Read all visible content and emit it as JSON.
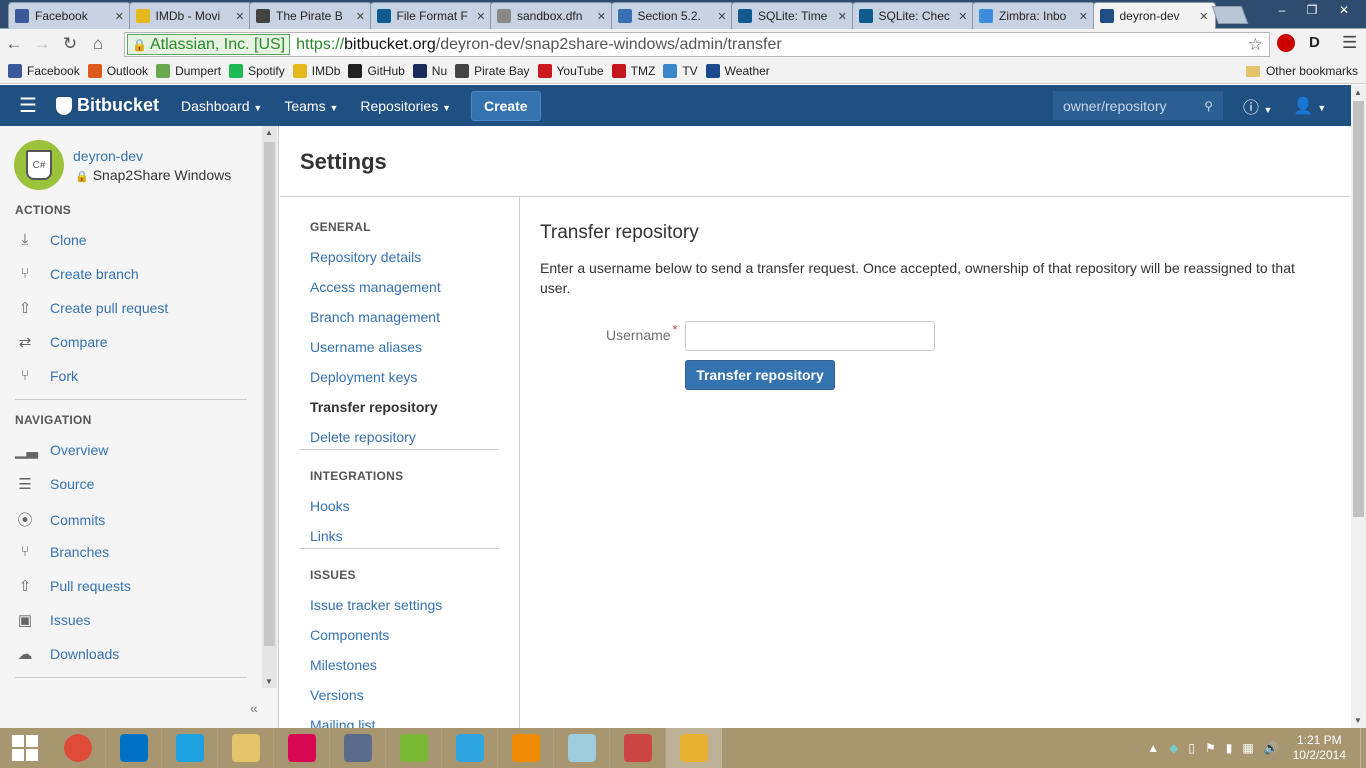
{
  "browser": {
    "tabs": [
      {
        "label": "Facebook",
        "icon": "facebook-icon",
        "color": "#3b5998"
      },
      {
        "label": "IMDb - Movi",
        "icon": "imdb-icon",
        "color": "#e5b91d"
      },
      {
        "label": "The Pirate B",
        "icon": "pirate-ship-icon",
        "color": "#444444"
      },
      {
        "label": "File Format F",
        "icon": "sqlite-icon",
        "color": "#0f5a8e"
      },
      {
        "label": "sandbox.dfn",
        "icon": "document-icon",
        "color": "#888888"
      },
      {
        "label": "Section 5.2.",
        "icon": "curve-icon",
        "color": "#3a6fb3"
      },
      {
        "label": "SQLite: Time",
        "icon": "sqlite-icon",
        "color": "#0f5a8e"
      },
      {
        "label": "SQLite: Chec",
        "icon": "sqlite-icon",
        "color": "#0f5a8e"
      },
      {
        "label": "Zimbra: Inbo",
        "icon": "zimbra-icon",
        "color": "#3b8ede"
      },
      {
        "label": "deyron-dev",
        "icon": "bitbucket-icon",
        "color": "#205081"
      }
    ],
    "ev_cert": "Atlassian, Inc. [US]",
    "url_scheme": "https://",
    "url_host": "bitbucket.org",
    "url_path": "/deyron-dev/snap2share-windows/admin/transfer",
    "bookmarks": [
      {
        "label": "Facebook",
        "icon": "facebook-icon",
        "color": "#3b5998"
      },
      {
        "label": "Outlook",
        "icon": "outlook-icon",
        "color": "#e05a1c"
      },
      {
        "label": "Dumpert",
        "icon": "dumpert-icon",
        "color": "#6aa84f"
      },
      {
        "label": "Spotify",
        "icon": "spotify-icon",
        "color": "#1db954"
      },
      {
        "label": "IMDb",
        "icon": "imdb-icon",
        "color": "#e5b91d"
      },
      {
        "label": "GitHub",
        "icon": "github-icon",
        "color": "#222222"
      },
      {
        "label": "Nu",
        "icon": "nu-icon",
        "color": "#1a2b5c"
      },
      {
        "label": "Pirate Bay",
        "icon": "pirate-ship-icon",
        "color": "#444444"
      },
      {
        "label": "YouTube",
        "icon": "youtube-icon",
        "color": "#cc181e"
      },
      {
        "label": "TMZ",
        "icon": "tmz-icon",
        "color": "#c4161c"
      },
      {
        "label": "TV",
        "icon": "tv-icon",
        "color": "#3a86c8"
      },
      {
        "label": "Weather",
        "icon": "twc-icon",
        "color": "#1b4a8c"
      }
    ],
    "other_bookmarks": "Other bookmarks"
  },
  "header": {
    "logo": "Bitbucket",
    "nav": [
      "Dashboard",
      "Teams",
      "Repositories"
    ],
    "create": "Create",
    "search_placeholder": "owner/repository"
  },
  "sidebar": {
    "owner": "deyron-dev",
    "repo": "Snap2Share Windows",
    "avatar_text": "C#",
    "actions_heading": "ACTIONS",
    "actions": [
      {
        "label": "Clone",
        "icon": "download-icon"
      },
      {
        "label": "Create branch",
        "icon": "branch-plus-icon"
      },
      {
        "label": "Create pull request",
        "icon": "pull-request-plus-icon"
      },
      {
        "label": "Compare",
        "icon": "shuffle-icon"
      },
      {
        "label": "Fork",
        "icon": "fork-icon"
      }
    ],
    "navigation_heading": "NAVIGATION",
    "navigation": [
      {
        "label": "Overview",
        "icon": "bar-chart-icon"
      },
      {
        "label": "Source",
        "icon": "file-icon"
      },
      {
        "label": "Commits",
        "icon": "commit-icon"
      },
      {
        "label": "Branches",
        "icon": "branch-icon"
      },
      {
        "label": "Pull requests",
        "icon": "pull-request-icon"
      },
      {
        "label": "Issues",
        "icon": "issue-icon"
      },
      {
        "label": "Downloads",
        "icon": "cloud-download-icon"
      }
    ]
  },
  "settings": {
    "title": "Settings",
    "general_heading": "GENERAL",
    "general": [
      "Repository details",
      "Access management",
      "Branch management",
      "Username aliases",
      "Deployment keys",
      "Transfer repository",
      "Delete repository"
    ],
    "integrations_heading": "INTEGRATIONS",
    "integrations": [
      "Hooks",
      "Links"
    ],
    "issues_heading": "ISSUES",
    "issues": [
      "Issue tracker settings",
      "Components",
      "Milestones",
      "Versions",
      "Mailing list"
    ]
  },
  "transfer": {
    "title": "Transfer repository",
    "description": "Enter a username below to send a transfer request. Once accepted, ownership of that repository will be reassigned to that user.",
    "username_label": "Username",
    "required_marker": "*",
    "username_value": "",
    "button": "Transfer repository"
  },
  "taskbar": {
    "time": "1:21 PM",
    "date": "10/2/2014",
    "apps": [
      {
        "icon": "chrome-icon",
        "color": "#dd4b39"
      },
      {
        "icon": "outlook-icon",
        "color": "#0072c6"
      },
      {
        "icon": "internet-explorer-icon",
        "color": "#1ea1e1"
      },
      {
        "icon": "file-explorer-icon",
        "color": "#e3c46a"
      },
      {
        "icon": "debian-icon",
        "color": "#d70751"
      },
      {
        "icon": "remote-desktop-icon",
        "color": "#5a6b8c"
      },
      {
        "icon": "utorrent-icon",
        "color": "#78b833"
      },
      {
        "icon": "telegram-icon",
        "color": "#2ca5e0"
      },
      {
        "icon": "vlc-icon",
        "color": "#f08a00"
      },
      {
        "icon": "notepad-icon",
        "color": "#9ecde0"
      },
      {
        "icon": "snipping-tool-icon",
        "color": "#c44"
      },
      {
        "icon": "window-switcher-icon",
        "color": "#e8b030"
      }
    ]
  }
}
